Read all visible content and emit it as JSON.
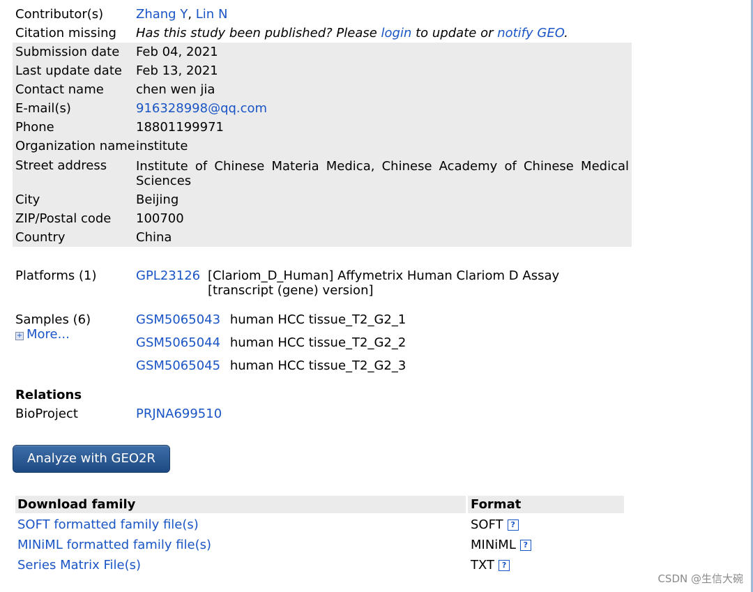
{
  "contributors": {
    "label": "Contributor(s)",
    "names": [
      "Zhang Y",
      "Lin N"
    ],
    "separator": ", "
  },
  "citation": {
    "label": "Citation missing",
    "text_before": "Has this study been published? Please ",
    "login": "login",
    "text_middle": " to update or ",
    "notify": "notify GEO",
    "text_after": "."
  },
  "contact": {
    "submission_date": {
      "label": "Submission date",
      "value": "Feb 04, 2021"
    },
    "last_update": {
      "label": "Last update date",
      "value": "Feb 13, 2021"
    },
    "name": {
      "label": "Contact name",
      "value": "chen wen jia"
    },
    "email": {
      "label": "E-mail(s)",
      "value": "916328998@qq.com"
    },
    "phone": {
      "label": "Phone",
      "value": "18801199971"
    },
    "organization": {
      "label": "Organization name",
      "value": "institute"
    },
    "street": {
      "label": "Street address",
      "value": "Institute of Chinese Materia Medica, Chinese Academy of Chinese Medical Sciences"
    },
    "city": {
      "label": "City",
      "value": "Beijing"
    },
    "zip": {
      "label": "ZIP/Postal code",
      "value": "100700"
    },
    "country": {
      "label": "Country",
      "value": "China"
    }
  },
  "platforms": {
    "label": "Platforms (1)",
    "items": [
      {
        "accession": "GPL23126",
        "line1": "[Clariom_D_Human] Affymetrix Human Clariom D Assay",
        "line2": "[transcript (gene) version]"
      }
    ]
  },
  "samples": {
    "label": "Samples (6)",
    "more": "More...",
    "items": [
      {
        "accession": "GSM5065043",
        "title": "human HCC tissue_T2_G2_1"
      },
      {
        "accession": "GSM5065044",
        "title": "human HCC tissue_T2_G2_2"
      },
      {
        "accession": "GSM5065045",
        "title": "human HCC tissue_T2_G2_3"
      }
    ]
  },
  "relations": {
    "heading": "Relations",
    "bioproject": {
      "label": "BioProject",
      "value": "PRJNA699510"
    }
  },
  "geo2r_button": "Analyze with GEO2R",
  "download": {
    "header_family": "Download family",
    "header_format": "Format",
    "help_glyph": "?",
    "rows": [
      {
        "file": "SOFT formatted family file(s)",
        "format": "SOFT"
      },
      {
        "file": "MINiML formatted family file(s)",
        "format": "MINiML"
      },
      {
        "file": "Series Matrix File(s)",
        "format": "TXT"
      }
    ]
  },
  "watermark": "CSDN @生信大碗"
}
